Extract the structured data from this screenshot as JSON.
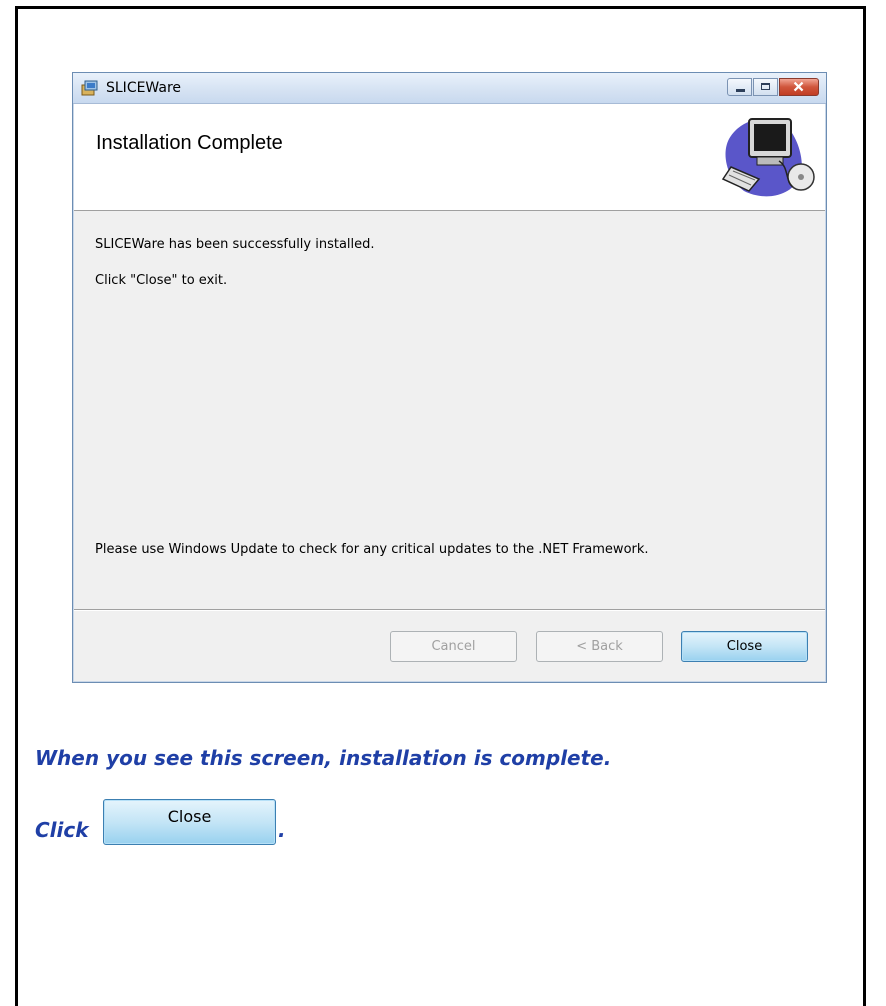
{
  "window": {
    "title": "SLICEWare",
    "header_title": "Installation Complete",
    "message_installed": "SLICEWare has been successfully installed.",
    "message_click_close": "Click \"Close\" to exit.",
    "message_update": "Please use Windows Update to check for any critical updates to the .NET Framework.",
    "buttons": {
      "cancel": "Cancel",
      "back": "< Back",
      "close": "Close"
    }
  },
  "caption": {
    "line1": "When you see this screen, installation is complete.",
    "click_prefix": "Click",
    "inline_button": "Close",
    "suffix": "."
  }
}
